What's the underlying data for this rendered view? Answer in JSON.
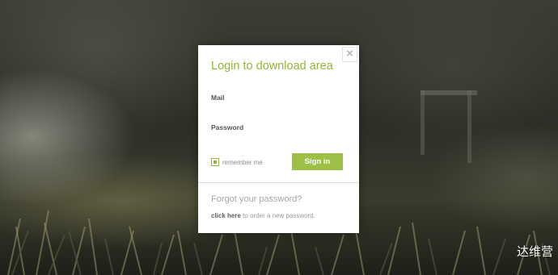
{
  "modal": {
    "title": "Login to download area",
    "close_symbol": "×",
    "mail_label": "Mail",
    "password_label": "Password",
    "remember_label": "remember me",
    "remember_checked": true,
    "signin_label": "Sign in",
    "forgot_text": "Forgot your password?",
    "order_link": "click here",
    "order_suffix": " to order a new password."
  },
  "colors": {
    "accent": "#93b438",
    "button": "#9cbf45"
  },
  "icons": {
    "close": "close-icon",
    "checkbox": "checkbox-icon"
  },
  "watermark": "达维营"
}
